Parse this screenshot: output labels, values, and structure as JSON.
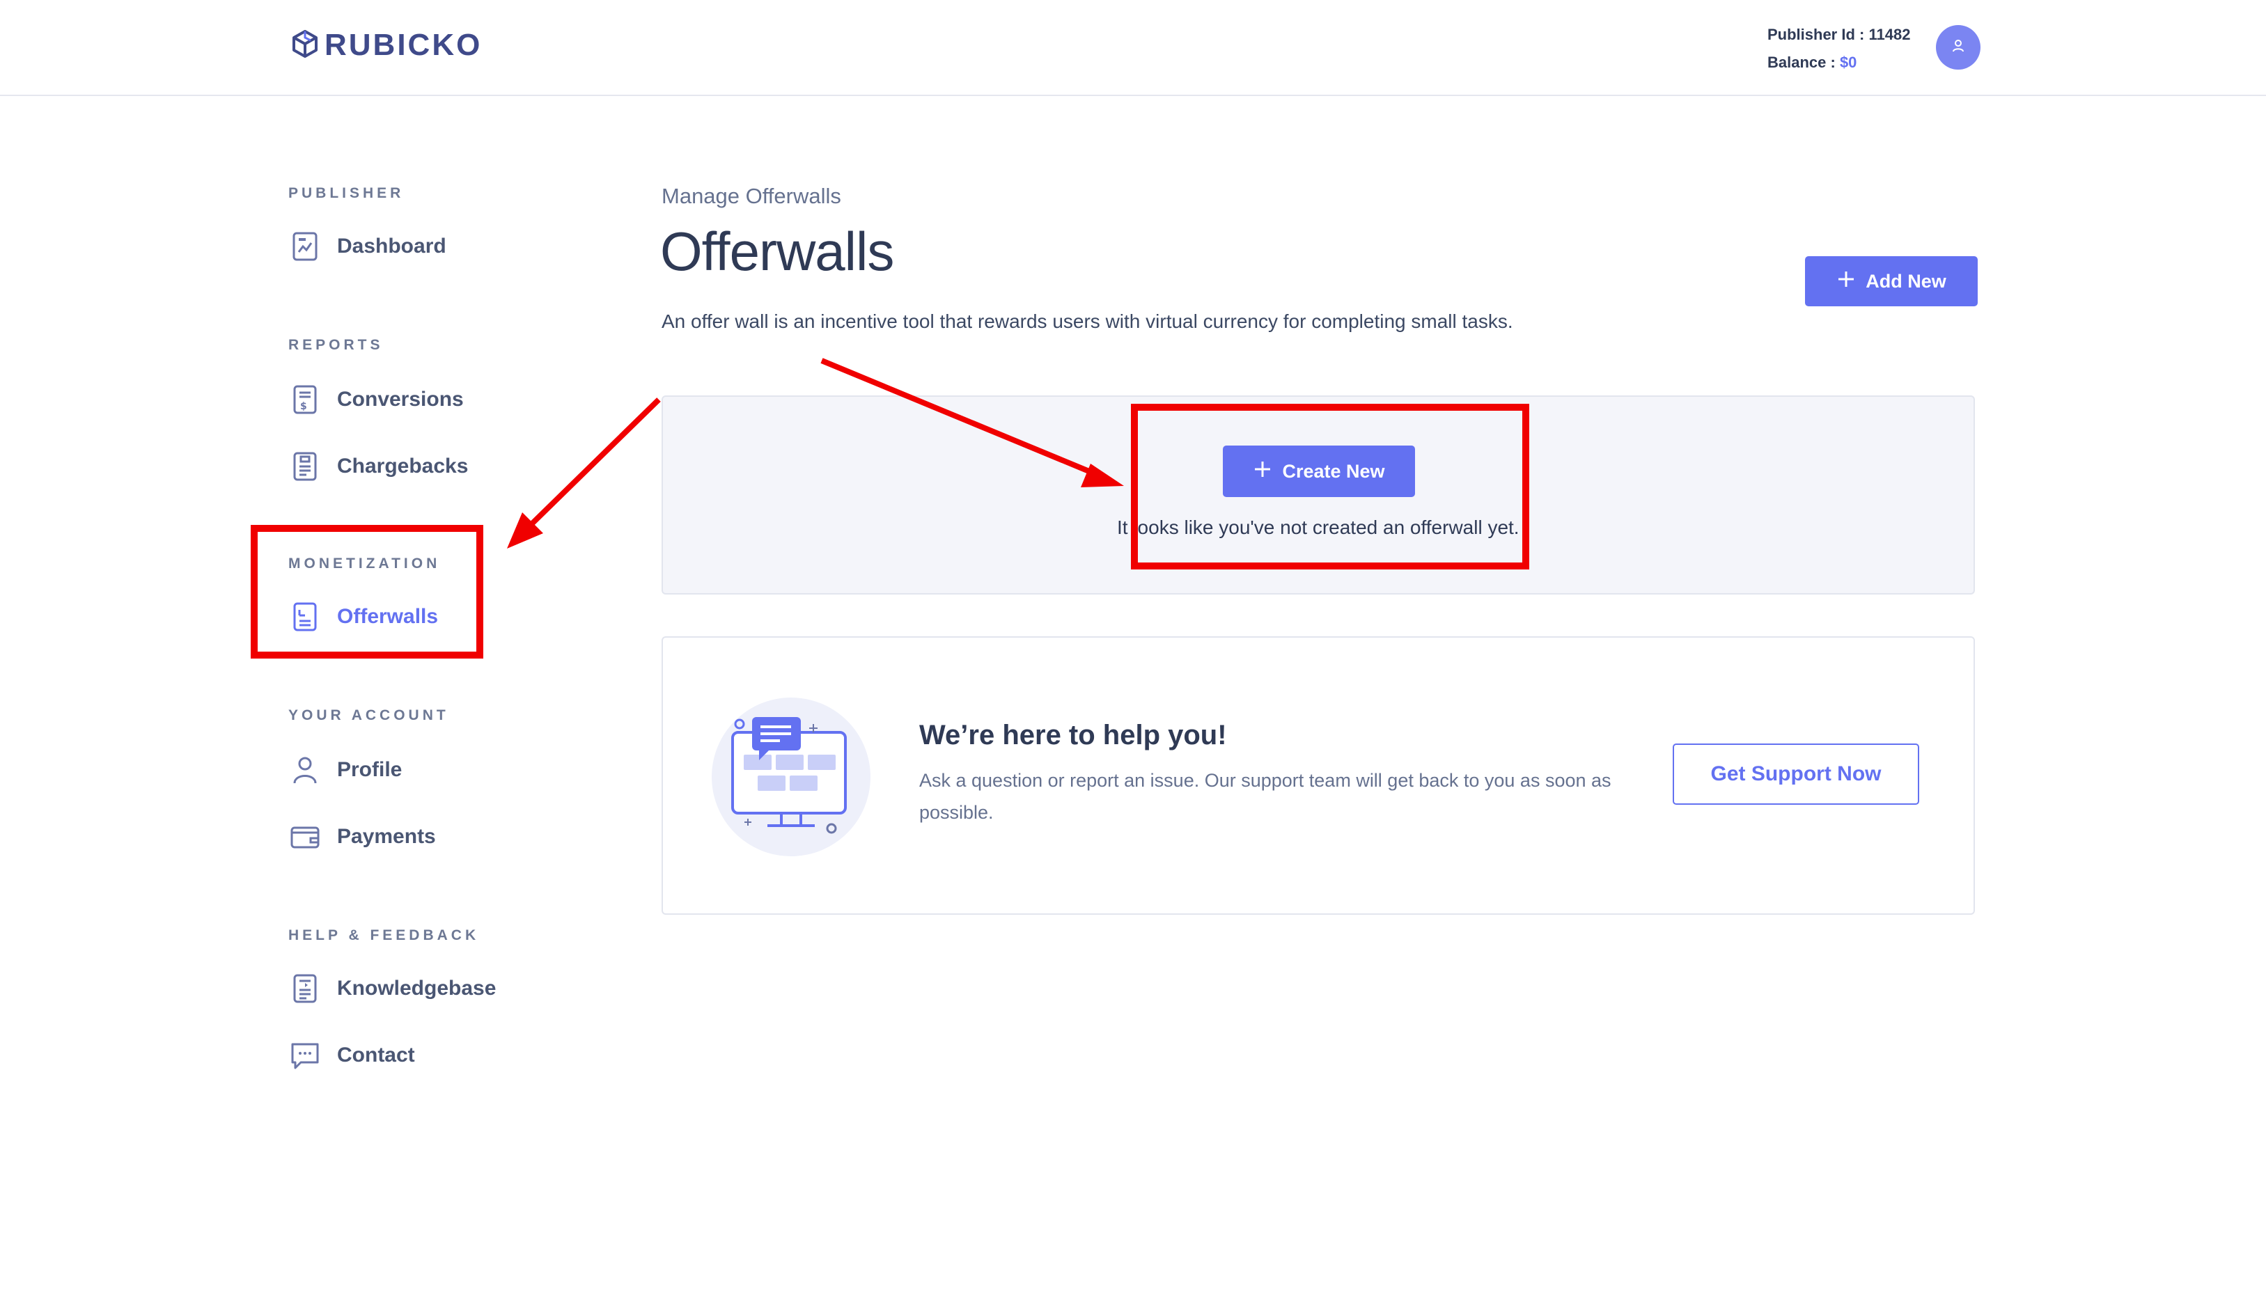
{
  "header": {
    "logo_text": "RUBICKO",
    "publisher_id_label": "Publisher Id : ",
    "publisher_id_value": "11482",
    "balance_label": "Balance : ",
    "balance_value": "$0",
    "avatar_icon": "user-icon"
  },
  "sidebar": {
    "sections": [
      {
        "label": "PUBLISHER",
        "items": [
          {
            "label": "Dashboard",
            "icon": "dashboard-icon"
          }
        ]
      },
      {
        "label": "REPORTS",
        "items": [
          {
            "label": "Conversions",
            "icon": "invoice-icon"
          },
          {
            "label": "Chargebacks",
            "icon": "receipt-icon"
          }
        ]
      },
      {
        "label": "MONETIZATION",
        "items": [
          {
            "label": "Offerwalls",
            "icon": "document-icon",
            "active": true
          }
        ]
      },
      {
        "label": "YOUR ACCOUNT",
        "items": [
          {
            "label": "Profile",
            "icon": "user-icon"
          },
          {
            "label": "Payments",
            "icon": "wallet-icon"
          }
        ]
      },
      {
        "label": "HELP & FEEDBACK",
        "items": [
          {
            "label": "Knowledgebase",
            "icon": "book-icon"
          },
          {
            "label": "Contact",
            "icon": "chat-icon"
          }
        ]
      }
    ]
  },
  "main": {
    "breadcrumb": "Manage Offerwalls",
    "title": "Offerwalls",
    "description": "An offer wall is an incentive tool that rewards users with virtual currency for completing small tasks.",
    "add_new_label": "Add New",
    "empty_state": {
      "button_label": "Create New",
      "message": "It looks like you've not created an offerwall yet."
    },
    "help": {
      "title": "We’re here to help you!",
      "text": "Ask a question or report an issue. Our support team will get back to you as soon as possible.",
      "button_label": "Get Support Now"
    }
  },
  "colors": {
    "accent": "#6371f1",
    "annotation": "#f00000",
    "text_dark": "#2f3a55",
    "text_muted": "#65718f"
  }
}
